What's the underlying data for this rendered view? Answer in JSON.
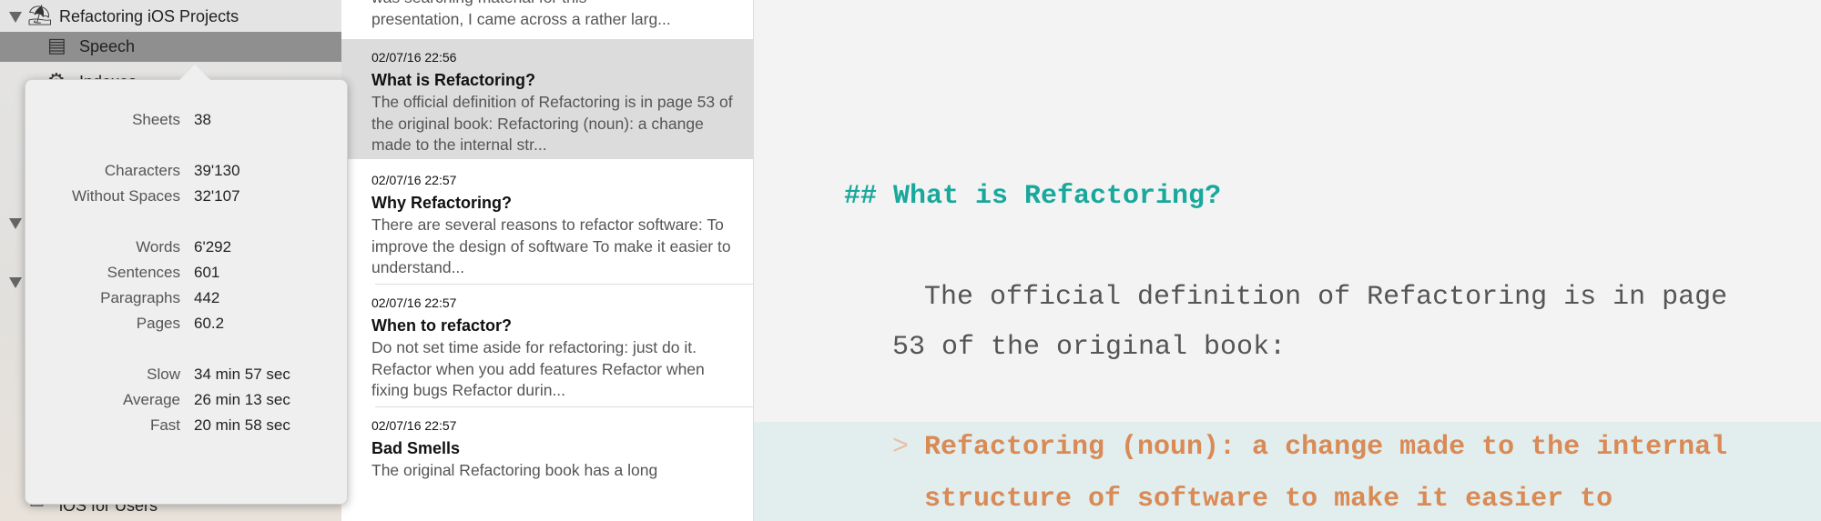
{
  "sidebar": {
    "project": "Refactoring iOS Projects",
    "items": [
      {
        "label": "Speech",
        "icon": "document-icon"
      },
      {
        "label": "Indexes",
        "icon": "gear-icon"
      }
    ],
    "bottom_item": "iOS for Users"
  },
  "popover": {
    "rows": [
      {
        "label": "Sheets",
        "value": "38"
      },
      {
        "label": "Characters",
        "value": "39'130"
      },
      {
        "label": "Without Spaces",
        "value": "32'107"
      },
      {
        "label": "Words",
        "value": "6'292"
      },
      {
        "label": "Sentences",
        "value": "601"
      },
      {
        "label": "Paragraphs",
        "value": "442"
      },
      {
        "label": "Pages",
        "value": "60.2"
      },
      {
        "label": "Slow",
        "value": "34 min 57 sec"
      },
      {
        "label": "Average",
        "value": "26 min 13 sec"
      },
      {
        "label": "Fast",
        "value": "20 min 58 sec"
      }
    ]
  },
  "list": {
    "partial_top": [
      "was searching material for this",
      "presentation, I came across a rather larg..."
    ],
    "items": [
      {
        "date": "02/07/16 22:56",
        "title": "What is Refactoring?",
        "preview": "The official definition of Refactoring is in page 53 of the original book: Refactoring (noun): a change made to the internal str..."
      },
      {
        "date": "02/07/16 22:57",
        "title": "Why Refactoring?",
        "preview": "There are several reasons to refactor software: To improve the design of software To make it easier to understand..."
      },
      {
        "date": "02/07/16 22:57",
        "title": "When to refactor?",
        "preview": "Do not set time aside for refactoring: just do it. Refactor when you add features Refactor when fixing bugs Refactor durin..."
      },
      {
        "date": "02/07/16 22:57",
        "title": "Bad Smells",
        "preview": "The original Refactoring book has a long"
      }
    ]
  },
  "editor": {
    "heading": "## What is Refactoring?",
    "para_line1": "The official definition of Refactoring is in page",
    "para_line2": "53 of the original book:",
    "quote_marker": ">",
    "quote_line1": "Refactoring (noun): a change made to the internal",
    "quote_line2": "structure of software to make it easier to",
    "colors": {
      "heading": "#19a89c",
      "text": "#555555",
      "quote": "#d98a55",
      "quote_bg": "#e2eded"
    }
  }
}
